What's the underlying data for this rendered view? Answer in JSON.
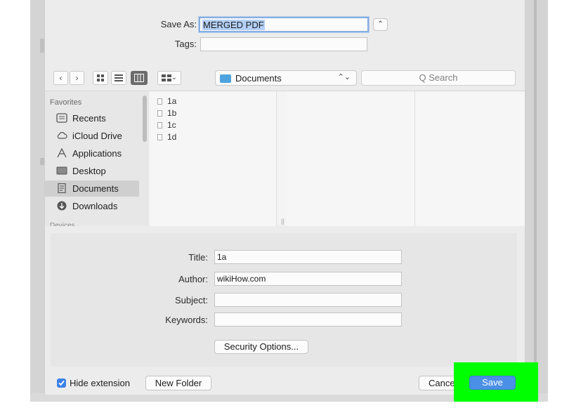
{
  "save_as": {
    "label": "Save As:",
    "value": "MERGED PDF",
    "toggle_glyph": "⌃"
  },
  "tags": {
    "label": "Tags:",
    "value": ""
  },
  "toolbar": {
    "back_glyph": "‹",
    "forward_glyph": "›",
    "location": "Documents",
    "location_updown_glyph": "⌃⌄",
    "search_placeholder": "Q Search",
    "group_glyph": "⌄"
  },
  "sidebar": {
    "heading": "Favorites",
    "items": [
      {
        "label": "Recents",
        "icon": "recents-icon",
        "selected": false
      },
      {
        "label": "iCloud Drive",
        "icon": "cloud-icon",
        "selected": false
      },
      {
        "label": "Applications",
        "icon": "applications-icon",
        "selected": false
      },
      {
        "label": "Desktop",
        "icon": "desktop-icon",
        "selected": false
      },
      {
        "label": "Documents",
        "icon": "documents-icon",
        "selected": true
      },
      {
        "label": "Downloads",
        "icon": "downloads-icon",
        "selected": false
      }
    ],
    "cut_heading": "Devices"
  },
  "files": [
    "1a",
    "1b",
    "1c",
    "1d"
  ],
  "column_grip": "||",
  "metadata": {
    "title_label": "Title:",
    "title_value": "1a",
    "author_label": "Author:",
    "author_value": "wikiHow.com",
    "subject_label": "Subject:",
    "subject_value": "",
    "keywords_label": "Keywords:",
    "keywords_value": "",
    "security_button": "Security Options..."
  },
  "footer": {
    "hide_extension_label": "Hide extension",
    "hide_extension_checked": true,
    "new_folder_button": "New Folder",
    "cancel_button": "Cancel",
    "save_button": "Save"
  },
  "colors": {
    "accent": "#4b8fe6",
    "highlight": "#00ff00",
    "folder": "#4da3de"
  }
}
